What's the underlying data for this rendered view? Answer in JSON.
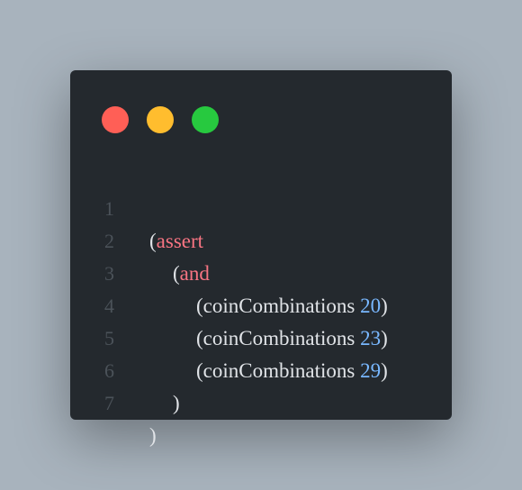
{
  "window": {
    "controls": {
      "close_color": "#ff5f56",
      "minimize_color": "#ffbd2e",
      "maximize_color": "#27c93f"
    }
  },
  "code": {
    "lines": [
      {
        "number": "1",
        "indent": 0,
        "open": "(",
        "keyword": "assert",
        "fn": "",
        "space": "",
        "num": "",
        "close": ""
      },
      {
        "number": "2",
        "indent": 1,
        "open": "(",
        "keyword": "and",
        "fn": "",
        "space": "",
        "num": "",
        "close": ""
      },
      {
        "number": "3",
        "indent": 2,
        "open": "(",
        "keyword": "",
        "fn": "coinCombinations",
        "space": " ",
        "num": "20",
        "close": ")"
      },
      {
        "number": "4",
        "indent": 2,
        "open": "(",
        "keyword": "",
        "fn": "coinCombinations",
        "space": " ",
        "num": "23",
        "close": ")"
      },
      {
        "number": "5",
        "indent": 2,
        "open": "(",
        "keyword": "",
        "fn": "coinCombinations",
        "space": " ",
        "num": "29",
        "close": ")"
      },
      {
        "number": "6",
        "indent": 1,
        "open": "",
        "keyword": "",
        "fn": "",
        "space": "",
        "num": "",
        "close": ")"
      },
      {
        "number": "7",
        "indent": 0,
        "open": "",
        "keyword": "",
        "fn": "",
        "space": "",
        "num": "",
        "close": ")"
      }
    ]
  }
}
